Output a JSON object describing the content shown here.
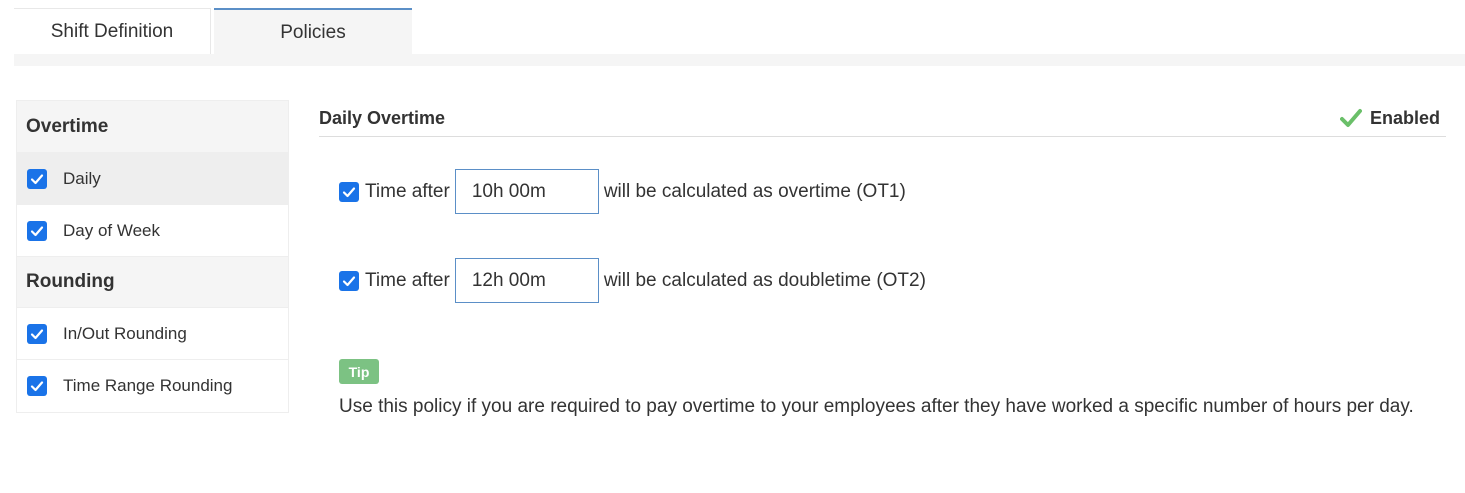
{
  "tabs": {
    "shift_definition": "Shift Definition",
    "policies": "Policies"
  },
  "sidebar": {
    "overtime_header": "Overtime",
    "rounding_header": "Rounding",
    "items": [
      {
        "label": "Daily",
        "checked": true,
        "active": true
      },
      {
        "label": "Day of Week",
        "checked": true
      },
      {
        "label": "In/Out Rounding",
        "checked": true
      },
      {
        "label": "Time Range Rounding",
        "checked": true
      }
    ]
  },
  "main": {
    "title": "Daily Overtime",
    "status": "Enabled",
    "status_color": "#6abf69",
    "rules": [
      {
        "prefix": "Time after",
        "value": "10h 00m",
        "suffix": "will be calculated as overtime (OT1)",
        "checked": true
      },
      {
        "prefix": "Time after",
        "value": "12h 00m",
        "suffix": "will be calculated as doubletime (OT2)",
        "checked": true
      }
    ],
    "tip_label": "Tip",
    "tip_text": "Use this policy if you are required to pay overtime to your employees after they have worked a specific number of hours per day."
  },
  "colors": {
    "accent": "#1a73e8",
    "tip_badge": "#7cc283",
    "active_tab_border": "#5b8fc7"
  }
}
